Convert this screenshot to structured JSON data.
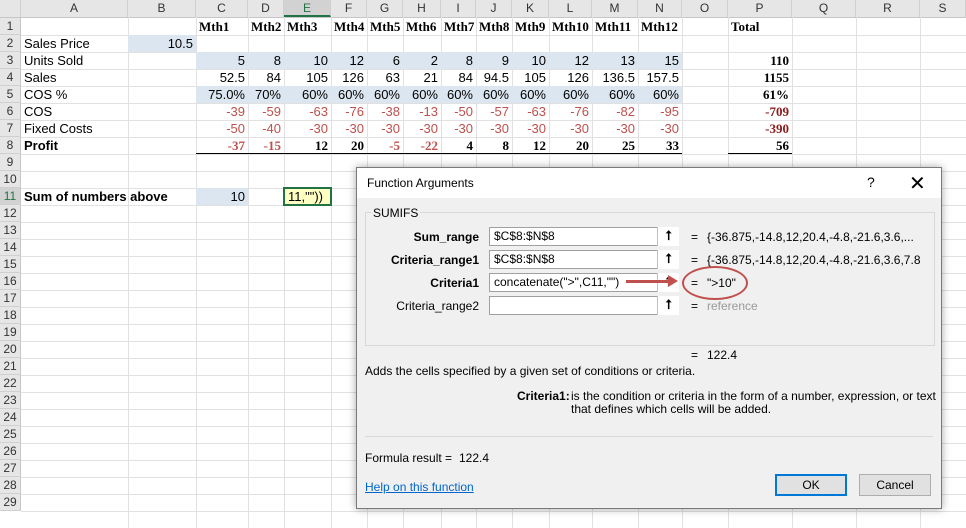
{
  "columns": [
    "A",
    "B",
    "C",
    "D",
    "E",
    "F",
    "G",
    "H",
    "I",
    "J",
    "K",
    "L",
    "M",
    "N",
    "O",
    "P",
    "Q",
    "R",
    "S"
  ],
  "rows": [
    "1",
    "2",
    "3",
    "4",
    "5",
    "6",
    "7",
    "8",
    "9",
    "10",
    "11",
    "12",
    "13",
    "14",
    "15",
    "16",
    "17",
    "18",
    "19",
    "20",
    "21",
    "22",
    "23",
    "24",
    "25",
    "26",
    "27",
    "28",
    "29"
  ],
  "sheet": {
    "months": [
      "Mth1",
      "Mth2",
      "Mth3",
      "Mth4",
      "Mth5",
      "Mth6",
      "Mth7",
      "Mth8",
      "Mth9",
      "Mth10",
      "Mth11",
      "Mth12"
    ],
    "total_label": "Total",
    "labels": {
      "sales_price": "Sales Price",
      "units_sold": "Units Sold",
      "sales": "Sales",
      "cos_pct": "COS %",
      "cos": "COS",
      "fixed_costs": "Fixed Costs",
      "profit": "Profit",
      "sum_above": "Sum of numbers above"
    },
    "sales_price_value": "10.5",
    "units": [
      "5",
      "8",
      "10",
      "12",
      "6",
      "2",
      "8",
      "9",
      "10",
      "12",
      "13",
      "15"
    ],
    "sales": [
      "52.5",
      "84",
      "105",
      "126",
      "63",
      "21",
      "84",
      "94.5",
      "105",
      "126",
      "136.5",
      "157.5"
    ],
    "cos_pct": [
      "75.0%",
      "70%",
      "60%",
      "60%",
      "60%",
      "60%",
      "60%",
      "60%",
      "60%",
      "60%",
      "60%",
      "60%"
    ],
    "cos": [
      "-39",
      "-59",
      "-63",
      "-76",
      "-38",
      "-13",
      "-50",
      "-57",
      "-63",
      "-76",
      "-82",
      "-95"
    ],
    "fixed": [
      "-50",
      "-40",
      "-30",
      "-30",
      "-30",
      "-30",
      "-30",
      "-30",
      "-30",
      "-30",
      "-30",
      "-30"
    ],
    "profit": [
      "-37",
      "-15",
      "12",
      "20",
      "-5",
      "-22",
      "4",
      "8",
      "12",
      "20",
      "25",
      "33"
    ],
    "totals": {
      "units": "110",
      "sales": "1155",
      "cos_pct": "61%",
      "cos": "-709",
      "fixed": "-390",
      "profit": "56"
    },
    "c11": "10",
    "e11_edit": "11,\"\"))"
  },
  "dialog": {
    "title": "Function Arguments",
    "help_glyph": "?",
    "close_glyph": "✕",
    "function_name": "SUMIFS",
    "args": [
      {
        "label": "Sum_range",
        "value": "$C$8:$N$8",
        "result": "{-36.875,-14.8,12,20.4,-4.8,-21.6,3.6,..."
      },
      {
        "label": "Criteria_range1",
        "value": "$C$8:$N$8",
        "result": "{-36.875,-14.8,12,20.4,-4.8,-21.6,3.6,7.8"
      },
      {
        "label": "Criteria1",
        "value": "concatenate(\">\",C11,\"\")",
        "result": "\">10\""
      },
      {
        "label": "Criteria_range2",
        "value": "",
        "result": "reference"
      }
    ],
    "equals": "=",
    "collapse_icon": "⭡",
    "overall_result": "122.4",
    "description": "Adds the cells specified by a given set of conditions or criteria.",
    "arg_help_label": "Criteria1:",
    "arg_help_text_1": "is the condition or criteria in the form of a number, expression, or text",
    "arg_help_text_2": "that defines which cells will be added.",
    "formula_result_label": "Formula result =",
    "formula_result_value": "122.4",
    "help_link": "Help on this function",
    "ok_label": "OK",
    "cancel_label": "Cancel"
  },
  "colors": {
    "accent_green": "#217346",
    "annotation_red": "#c0504d",
    "input_blue": "#dce6f1"
  }
}
